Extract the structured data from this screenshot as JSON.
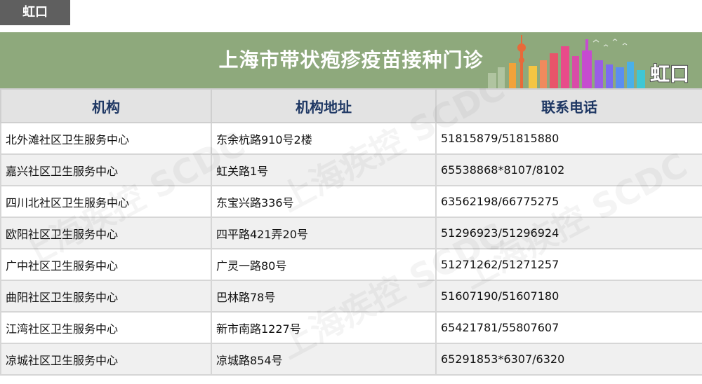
{
  "tag_label": "虹口",
  "banner": {
    "title": "上海市带状疱疹疫苗接种门诊",
    "district": "虹口",
    "bg_color": "#8ea97c"
  },
  "table": {
    "headers": [
      "机构",
      "机构地址",
      "联系电话"
    ],
    "rows": [
      {
        "name": "北外滩社区卫生服务中心",
        "address": "东余杭路910号2楼",
        "phone": "51815879/51815880"
      },
      {
        "name": "嘉兴社区卫生服务中心",
        "address": "虹关路1号",
        "phone": "65538868*8107/8102"
      },
      {
        "name": "四川北社区卫生服务中心",
        "address": "东宝兴路336号",
        "phone": "63562198/66775275"
      },
      {
        "name": "欧阳社区卫生服务中心",
        "address": "四平路421弄20号",
        "phone": "51296923/51296924"
      },
      {
        "name": "广中社区卫生服务中心",
        "address": "广灵一路80号",
        "phone": "51271262/51271257"
      },
      {
        "name": "曲阳社区卫生服务中心",
        "address": "巴林路78号",
        "phone": "51607190/51607180"
      },
      {
        "name": "江湾社区卫生服务中心",
        "address": "新市南路1227号",
        "phone": "65421781/55807607"
      },
      {
        "name": "凉城社区卫生服务中心",
        "address": "凉城路854号",
        "phone": "65291853*6307/6320"
      }
    ]
  },
  "watermark_text": "上海疾控 SCDC"
}
